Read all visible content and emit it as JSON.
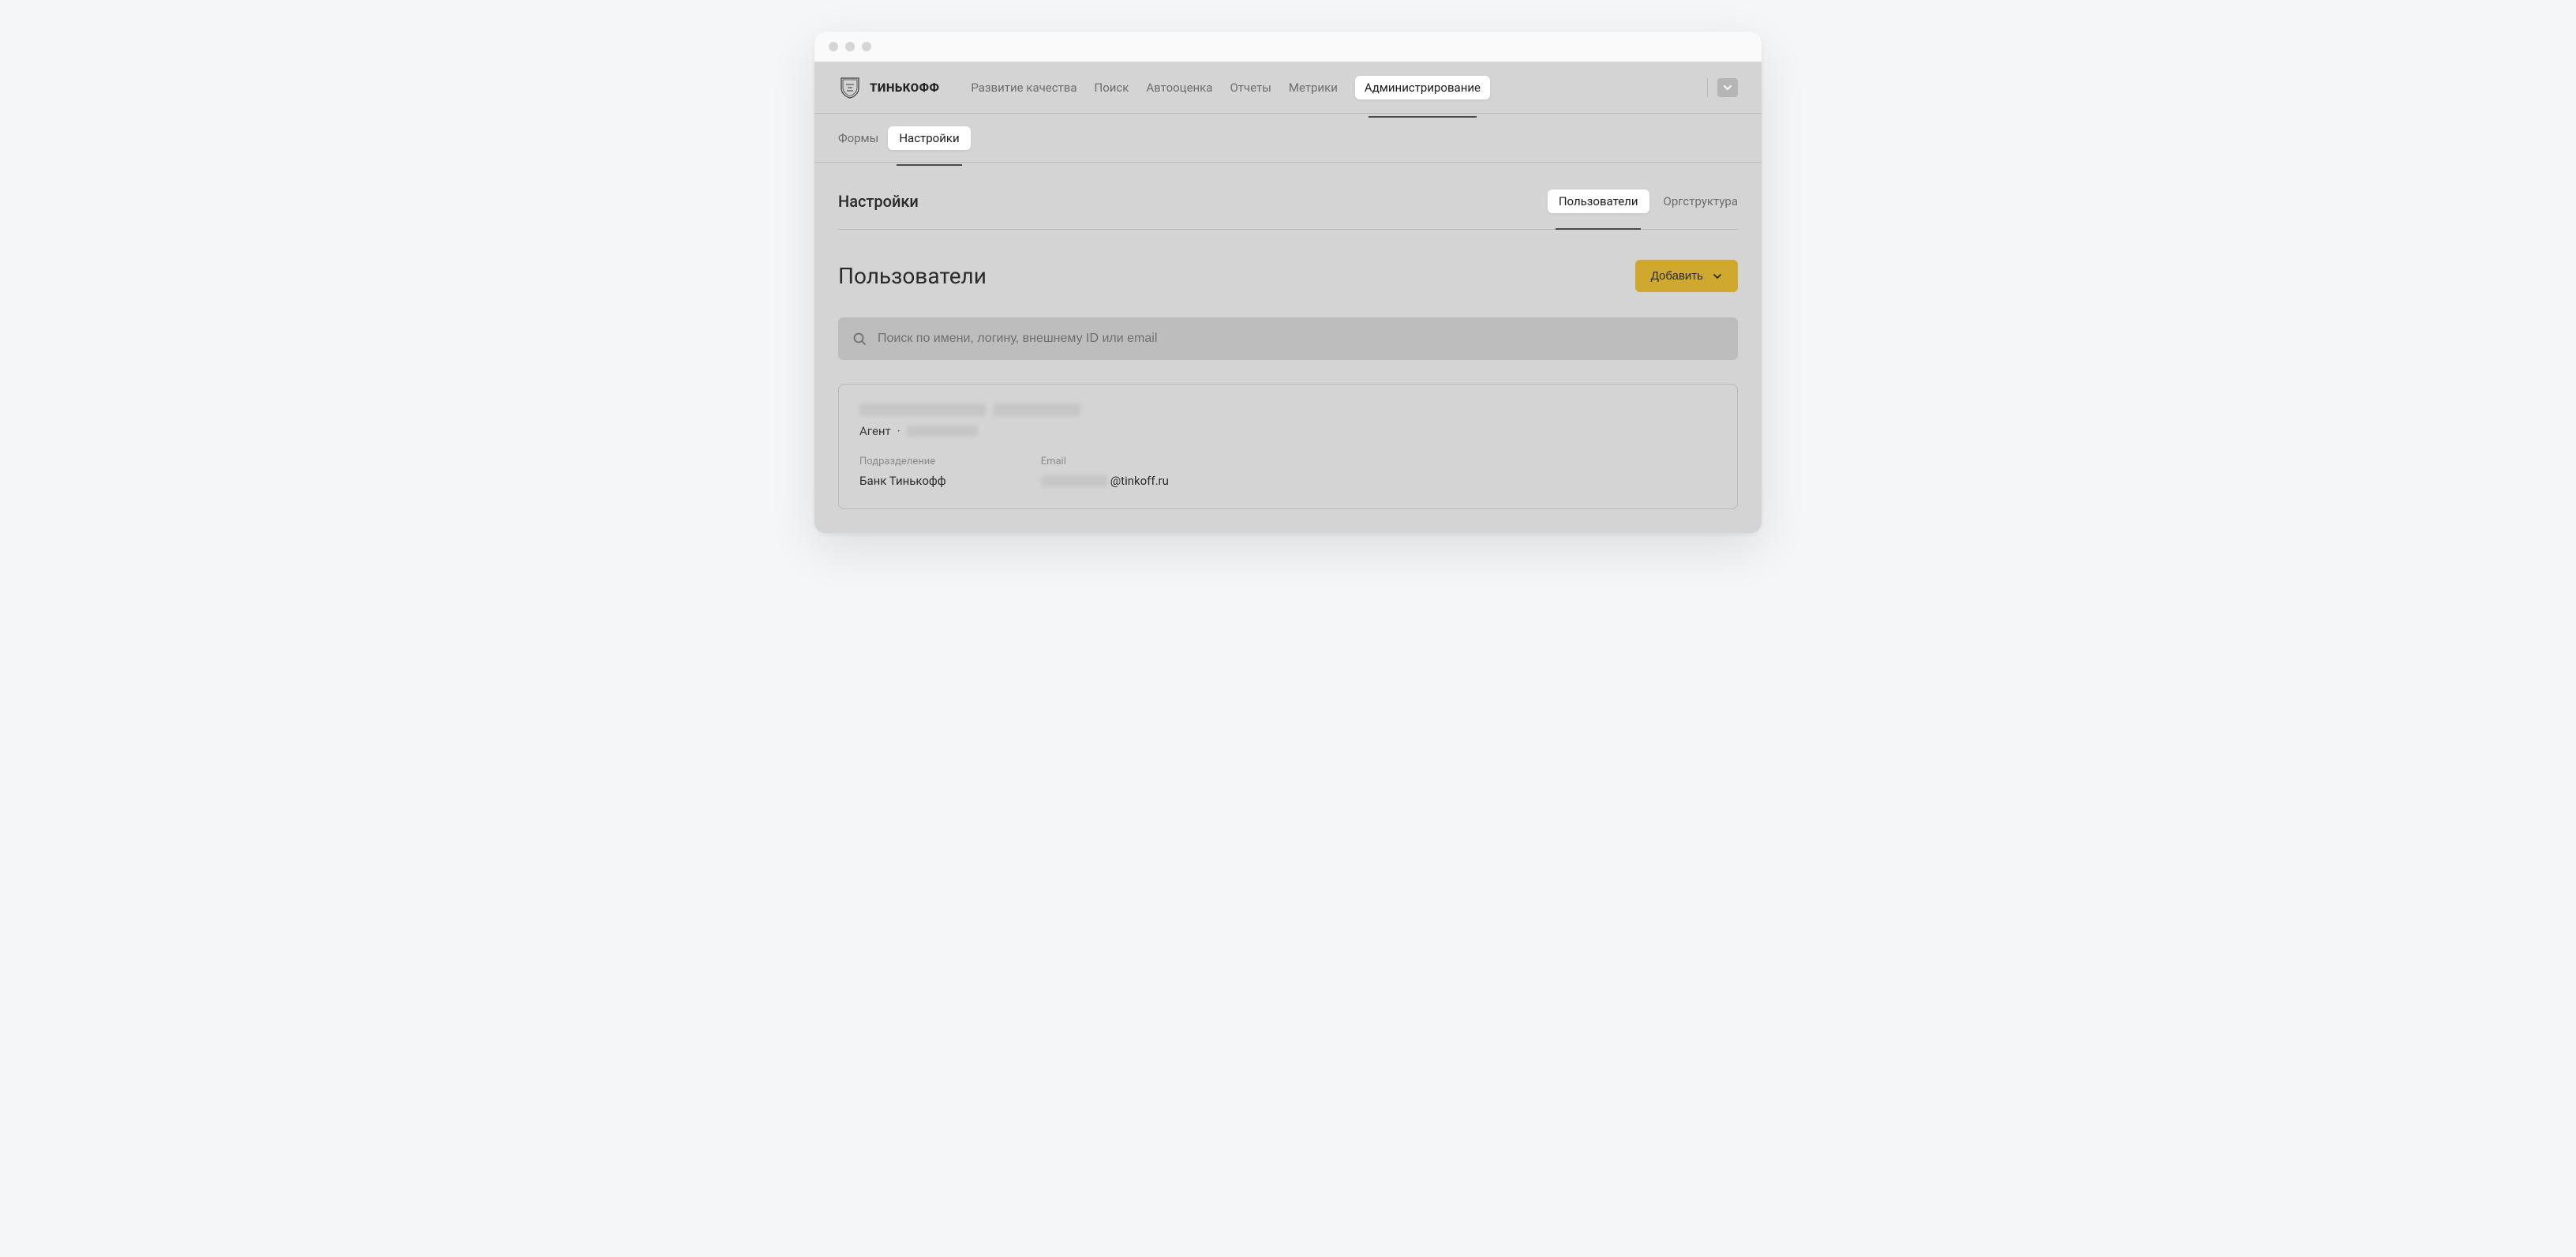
{
  "brand": {
    "name": "ТИНЬКОФФ"
  },
  "nav": {
    "items": [
      {
        "label": "Развитие качества"
      },
      {
        "label": "Поиск"
      },
      {
        "label": "Автооценка"
      },
      {
        "label": "Отчеты"
      },
      {
        "label": "Метрики"
      },
      {
        "label": "Администрирование"
      }
    ],
    "active_index": 5
  },
  "subnav": {
    "items": [
      {
        "label": "Формы"
      },
      {
        "label": "Настройки"
      }
    ],
    "active_index": 1
  },
  "settings": {
    "title": "Настройки",
    "tabs": [
      {
        "label": "Пользователи"
      },
      {
        "label": "Оргструктура"
      }
    ],
    "active_tab_index": 0
  },
  "page": {
    "title": "Пользователи",
    "add_button_label": "Добавить"
  },
  "search": {
    "placeholder": "Поиск по имени, логину, внешнему ID или email",
    "value": ""
  },
  "user_card": {
    "role_label": "Агент",
    "separator": "·",
    "department_label": "Подразделение",
    "department_value": "Банк Тинькофф",
    "email_label": "Email",
    "email_domain": "@tinkoff.ru"
  },
  "colors": {
    "accent": "#cfa92e"
  }
}
